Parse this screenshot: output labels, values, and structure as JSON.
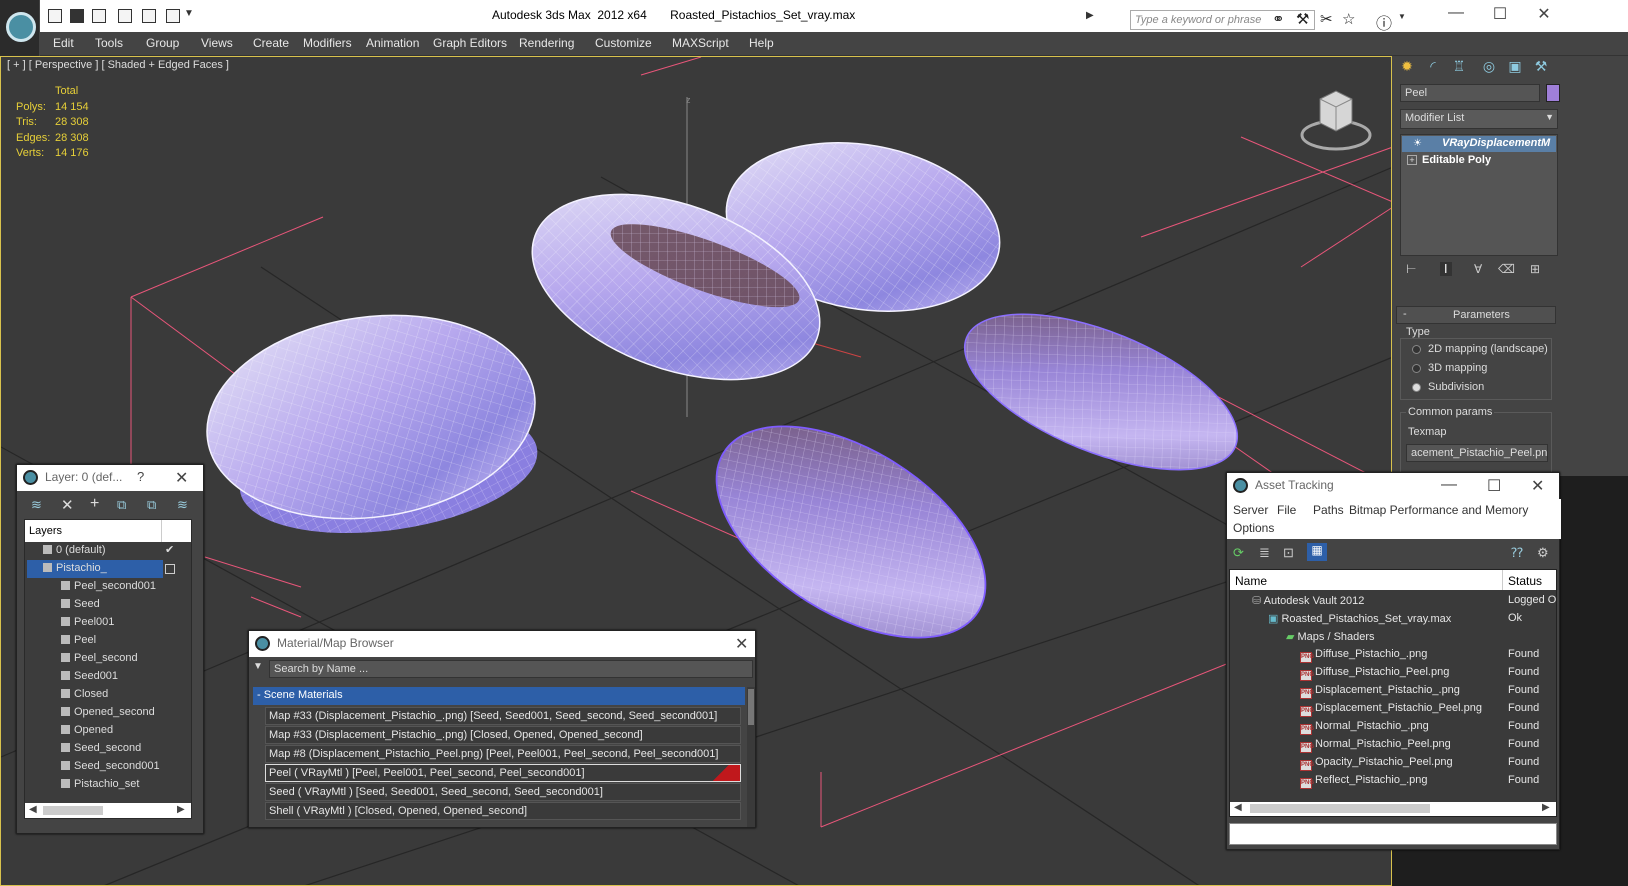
{
  "app": {
    "title": "Autodesk 3ds Max  2012 x64       Roasted_Pistachios_Set_vray.max",
    "search_placeholder": "Type a keyword or phrase"
  },
  "menu": [
    "Edit",
    "Tools",
    "Group",
    "Views",
    "Create",
    "Modifiers",
    "Animation",
    "Graph Editors",
    "Rendering",
    "Customize",
    "MAXScript",
    "Help"
  ],
  "viewport": {
    "label": "[ + ] [ Perspective ] [ Shaded + Edged Faces ]",
    "stats_header": "Total",
    "stats": [
      {
        "label": "Polys:",
        "value": "14 154"
      },
      {
        "label": "Tris:",
        "value": "28 308"
      },
      {
        "label": "Edges:",
        "value": "28 308"
      },
      {
        "label": "Verts:",
        "value": "14 176"
      }
    ],
    "grid_axis_label": "z"
  },
  "command_panel": {
    "object_name": "Peel",
    "object_color": "#9f7fd8",
    "modifier_list_label": "Modifier List",
    "stack": [
      "VRayDisplacementM",
      "Editable Poly"
    ],
    "rollout_title": "Parameters",
    "type_group": "Type",
    "type_options": [
      "2D mapping (landscape)",
      "3D mapping",
      "Subdivision"
    ],
    "type_selected": 2,
    "common_group": "Common params",
    "texmap_label": "Texmap",
    "texmap_value": "acement_Pistachio_Peel.png)"
  },
  "layer_panel": {
    "title": "Layer: 0 (def...",
    "help": "?",
    "header": "Layers",
    "rows": [
      "0 (default)",
      "Pistachio_",
      "Peel_second001",
      "Seed",
      "Peel001",
      "Peel",
      "Peel_second",
      "Seed001",
      "Closed",
      "Opened_second",
      "Opened",
      "Seed_second",
      "Seed_second001",
      "Pistachio_set"
    ]
  },
  "material_browser": {
    "title": "Material/Map Browser",
    "search_placeholder": "Search by Name ...",
    "group": "- Scene Materials",
    "rows": [
      "Map #33 (Displacement_Pistachio_.png) [Seed, Seed001, Seed_second, Seed_second001]",
      "Map #33 (Displacement_Pistachio_.png) [Closed, Opened, Opened_second]",
      "Map #8 (Displacement_Pistachio_Peel.png) [Peel, Peel001, Peel_second, Peel_second001]",
      "Peel  ( VRayMtl )  [Peel, Peel001, Peel_second, Peel_second001]",
      "Seed  ( VRayMtl )  [Seed, Seed001, Seed_second, Seed_second001]",
      "Shell  ( VRayMtl )  [Closed, Opened, Opened_second]"
    ]
  },
  "asset_tracking": {
    "title": "Asset Tracking",
    "menu": [
      "Server",
      "File",
      "Paths",
      "Bitmap Performance and Memory",
      "Options"
    ],
    "col_name": "Name",
    "col_status": "Status",
    "rows": [
      {
        "name": "Autodesk Vault 2012",
        "status": "Logged O"
      },
      {
        "name": "Roasted_Pistachios_Set_vray.max",
        "status": "Ok"
      },
      {
        "name": "Maps / Shaders",
        "status": ""
      },
      {
        "name": "Diffuse_Pistachio_.png",
        "status": "Found"
      },
      {
        "name": "Diffuse_Pistachio_Peel.png",
        "status": "Found"
      },
      {
        "name": "Displacement_Pistachio_.png",
        "status": "Found"
      },
      {
        "name": "Displacement_Pistachio_Peel.png",
        "status": "Found"
      },
      {
        "name": "Normal_Pistachio_.png",
        "status": "Found"
      },
      {
        "name": "Normal_Pistachio_Peel.png",
        "status": "Found"
      },
      {
        "name": "Opacity_Pistachio_Peel.png",
        "status": "Found"
      },
      {
        "name": "Reflect_Pistachio_.png",
        "status": "Found"
      }
    ],
    "icon_text": "PNG"
  }
}
